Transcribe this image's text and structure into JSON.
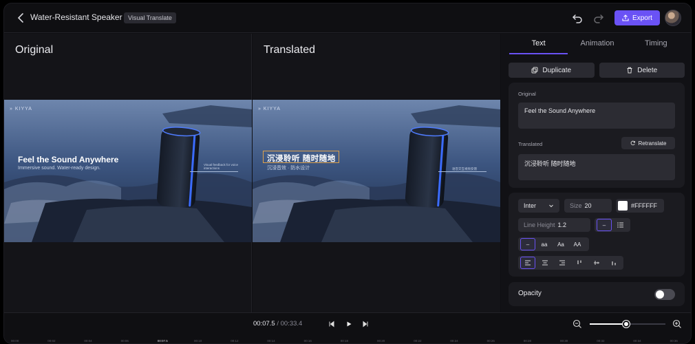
{
  "header": {
    "title": "Water-Resistant Speaker Ad",
    "tag": "Visual Translate",
    "export_label": "Export"
  },
  "panes": {
    "original_title": "Original",
    "translated_title": "Translated"
  },
  "scene_original": {
    "logo": "KIYYA",
    "headline": "Feel the Sound Anywhere",
    "subline": "Immersive sound. Water-ready design.",
    "callout": "Visual feedback for voice interactions"
  },
  "scene_translated": {
    "logo": "KIYYA",
    "headline": "沉浸聆听 随时随地",
    "subline": "沉浸音效 · 防水设计",
    "callout": "语音交互视觉反馈"
  },
  "side": {
    "tabs": [
      "Text",
      "Animation",
      "Timing"
    ],
    "duplicate_label": "Duplicate",
    "delete_label": "Delete",
    "original_label": "Original",
    "original_text": "Feel the Sound Anywhere",
    "translated_label": "Translated",
    "retranslate_label": "Retranslate",
    "translated_text": "沉浸聆听 随时随地",
    "font": "Inter",
    "size_label": "Size",
    "size_value": "20",
    "color_value": "#FFFFFF",
    "line_height_label": "Line Height",
    "line_height_value": "1.2",
    "case_options": [
      "–",
      "aa",
      "Aa",
      "AA"
    ],
    "opacity_label": "Opacity"
  },
  "timeline": {
    "current": "00:07.5",
    "total": "/ 00:33.4",
    "ticks": [
      "00:00",
      "00:02",
      "00:04",
      "00:06",
      "00:07.5",
      "00:10",
      "00:12",
      "00:14",
      "00:16",
      "00:18",
      "00:20",
      "00:22",
      "00:24",
      "00:26",
      "00:28",
      "00:30",
      "00:32",
      "00:34",
      "00:36"
    ]
  },
  "colors": {
    "accent": "#6a52f5",
    "selection": "#e0a24a",
    "background": "#0f0f12"
  }
}
